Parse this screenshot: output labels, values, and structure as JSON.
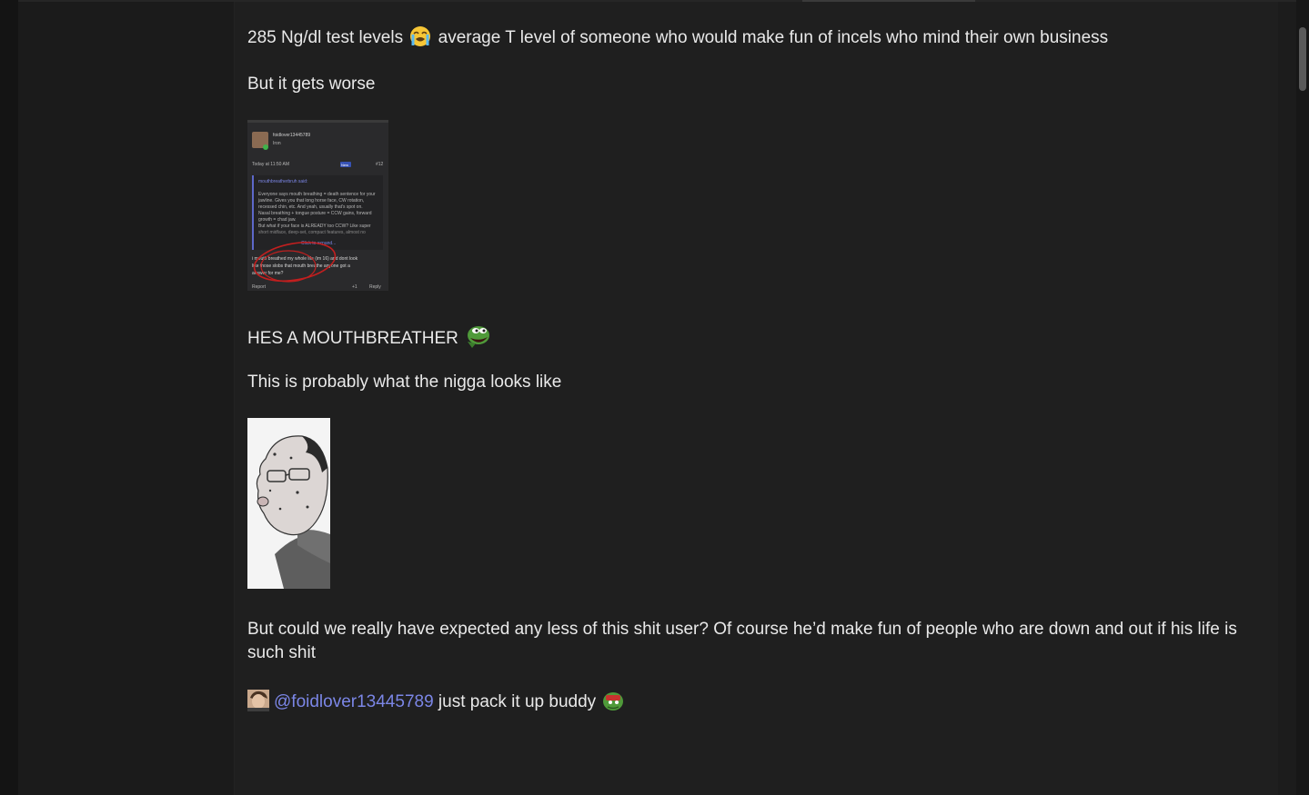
{
  "post": {
    "line1_text": "285 Ng/dl test levels",
    "line1_emoji": "sob-emoji",
    "line1_rest": "average T level of someone who would make fun of incels who mind their own business",
    "line2": "But it gets worse",
    "screenshot": {
      "username": "foidlover13445789",
      "role": "Iron",
      "timestamp": "Today at 11:50 AM",
      "post_number": "#12",
      "new_badge": "New",
      "quote_author": "mouthbreatherbruh said:",
      "quote_lines": [
        "Everyone says mouth breathing = death sentence for your",
        "jawline. Gives you that long horse face, CW rotation,",
        "recessed chin, etc. And yeah, usually that's spot on.",
        "Nasal breathing + tongue posture = CCW gains, forward",
        "growth = chad jaw.",
        "But what if your face is ALREADY too CCW? Like super",
        "short midface, deep-set, compact features, almost no"
      ],
      "expand_label": "Click to expand...",
      "reply_lines": [
        "i mouth breathed my whole life (im 16) and dont look",
        "like those slobs that mouth breathe anyone got a",
        "answer for me?"
      ],
      "report_label": "Report",
      "like_label": "+1",
      "reply_label": "Reply"
    },
    "line3": "HES A MOUTHBREATHER",
    "line3_emoji": "pepe-scream-emoji",
    "line4": "This is probably what the nigga looks like",
    "line5": "But could we really have expected any less of this shit user? Of course he’d make fun of people who are down and out if his life is such shit",
    "mention": {
      "handle": "@foidlover13445789",
      "after_text": "just pack it up buddy",
      "emoji": "pepe-cope-emoji"
    }
  },
  "colors": {
    "background": "#1f1f1f",
    "text": "#e9e9e9",
    "mention": "#7b86e6"
  }
}
